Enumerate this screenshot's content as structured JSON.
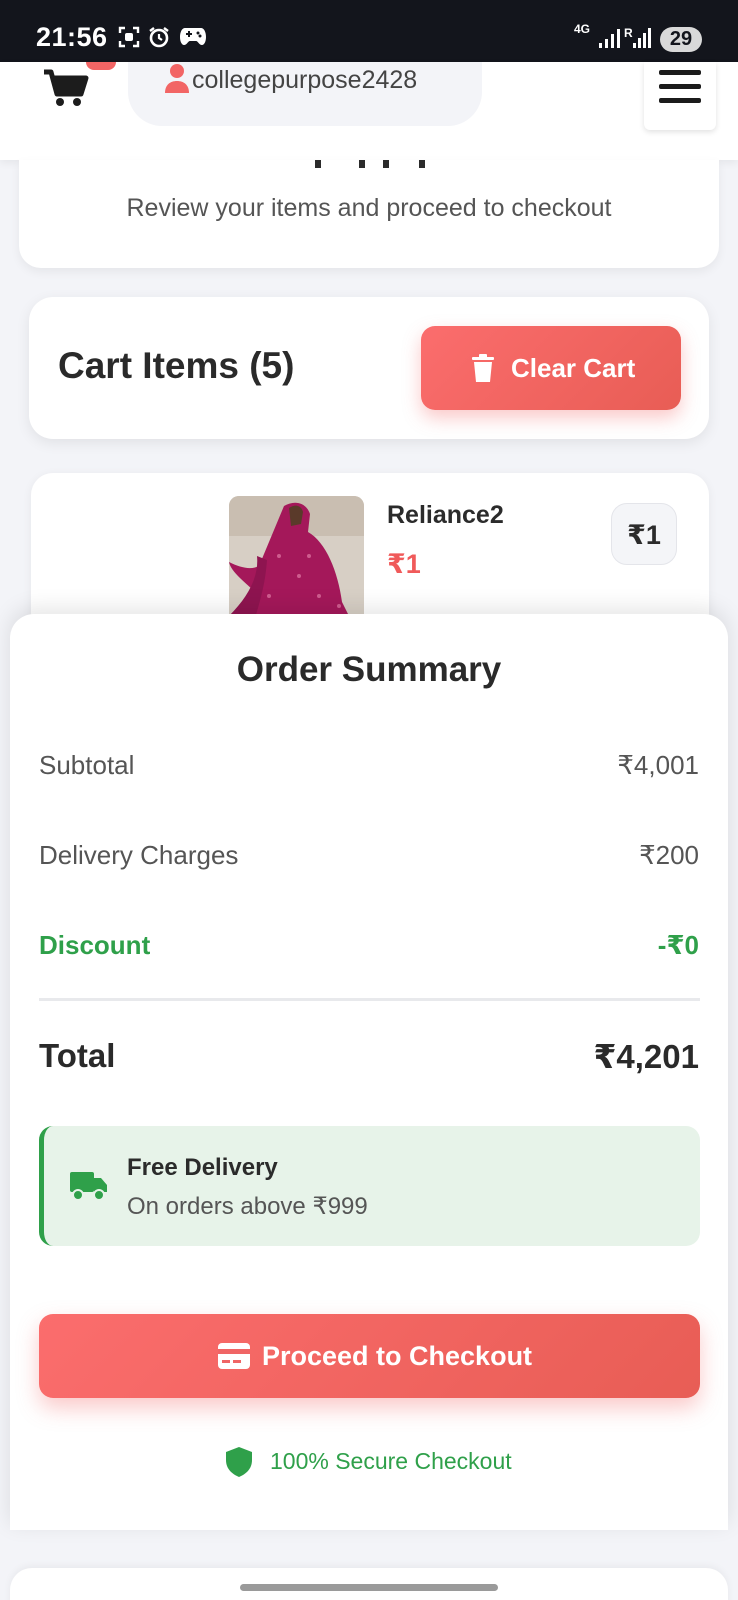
{
  "status_bar": {
    "time": "21:56",
    "network": "4G",
    "battery": "29",
    "icons": [
      "screenshot-icon",
      "alarm-icon",
      "game-icon",
      "signal-icon",
      "signal-roaming-icon"
    ]
  },
  "header": {
    "username": "collegepurpose2428",
    "icons": [
      "cart-icon",
      "user-icon",
      "menu-icon"
    ]
  },
  "page": {
    "subtitle": "Review your items and proceed to checkout"
  },
  "cart": {
    "title": "Cart Items (5)",
    "clear_label": "Clear Cart",
    "items": [
      {
        "name": "Reliance2",
        "price": "₹1",
        "line_total": "₹1"
      }
    ]
  },
  "summary": {
    "title": "Order Summary",
    "rows": [
      {
        "label": "Subtotal",
        "value": "₹4,001"
      },
      {
        "label": "Delivery Charges",
        "value": "₹200"
      },
      {
        "label": "Discount",
        "value": "-₹0"
      }
    ],
    "total_label": "Total",
    "total_value": "₹4,201",
    "free_delivery": {
      "title": "Free Delivery",
      "subtitle": "On orders above ₹999"
    },
    "checkout_label": "Proceed to Checkout",
    "secure_label": "100% Secure Checkout"
  },
  "colors": {
    "accent": "#f26565",
    "success": "#2fa04a",
    "status_bar": "#13151c"
  }
}
